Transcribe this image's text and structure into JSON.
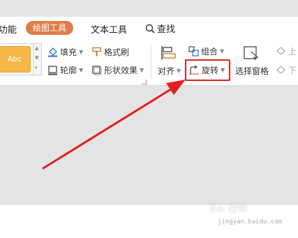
{
  "tabs": {
    "partial_left": "功能",
    "drawing_tools": "绘图工具",
    "text_tools": "文本工具",
    "search": "查找"
  },
  "ribbon": {
    "style_preview": "Abc",
    "fill": "填充",
    "format_painter": "格式刷",
    "outline": "轮廓",
    "shape_effects": "形状效果",
    "align": "对齐",
    "group": "组合",
    "rotate": "旋转",
    "selection_pane": "选择窗格",
    "move_up": "上",
    "move_down": "下"
  },
  "watermark": {
    "text": "Bai 经验",
    "sub": "jingyan.baidu.com"
  },
  "colors": {
    "accent_tab": "#e07e4a",
    "highlight": "#e02020",
    "arrow": "#e02020",
    "style_preview_fill": "#f7b84a"
  }
}
